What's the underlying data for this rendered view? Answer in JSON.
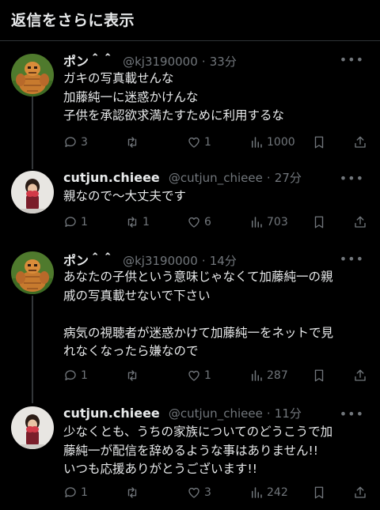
{
  "header": {
    "title": "返信をさらに表示"
  },
  "replies": [
    {
      "name": "ポン＾＾",
      "handle": "@kj3190000",
      "time": "33分",
      "lines": [
        "ガキの写真載せんな",
        "加藤純一に迷惑かけんな",
        "子供を承認欲求満たすために利用するな"
      ],
      "replies_count": "3",
      "retweets": "",
      "likes": "1",
      "views": "1000"
    },
    {
      "name": "cutjun.chieee",
      "handle": "@cutjun_chieee",
      "time": "27分",
      "lines": [
        "親なので〜大丈夫です"
      ],
      "replies_count": "1",
      "retweets": "1",
      "likes": "6",
      "views": "703"
    },
    {
      "name": "ポン＾＾",
      "handle": "@kj3190000",
      "time": "14分",
      "lines": [
        "あなたの子供という意味じゃなくて加藤純一の親",
        "戚の写真載せないで下さい",
        "",
        "病気の視聴者が迷惑かけて加藤純一をネットで見",
        "れなくなったら嫌なので"
      ],
      "replies_count": "1",
      "retweets": "",
      "likes": "1",
      "views": "287"
    },
    {
      "name": "cutjun.chieee",
      "handle": "@cutjun_chieee",
      "time": "11分",
      "lines": [
        "少なくとも、うちの家族についてのどうこうで加",
        "藤純一が配信を辞めるような事はありません!!",
        "いつも応援ありがとうございます!!"
      ],
      "replies_count": "1",
      "retweets": "",
      "likes": "3",
      "views": "242"
    }
  ],
  "icons": {
    "reply": "reply-icon",
    "retweet": "retweet-icon",
    "like": "like-icon",
    "views": "views-icon",
    "bookmark": "bookmark-icon",
    "share": "share-icon",
    "more": "more-icon"
  }
}
